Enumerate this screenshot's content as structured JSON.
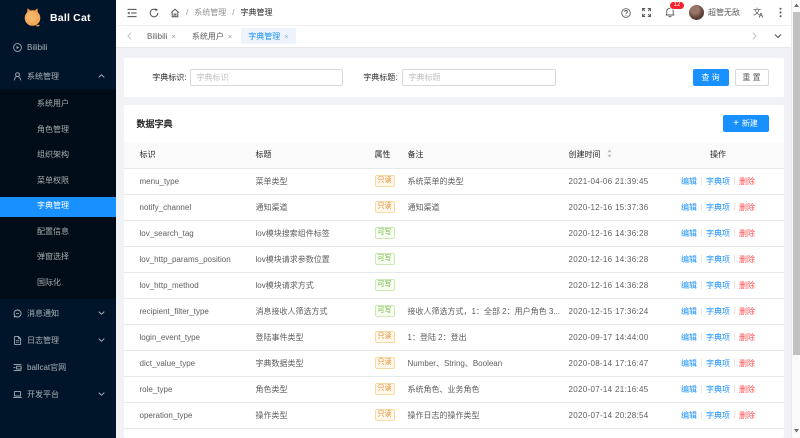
{
  "app": {
    "logo_text": "Ball Cat"
  },
  "sidebar": {
    "top_items": [
      {
        "label": "Bilibili",
        "icon": "play-circle-icon",
        "caret": ""
      },
      {
        "label": "系统管理",
        "icon": "user-icon",
        "caret": "up"
      }
    ],
    "submenu": [
      {
        "label": "系统用户",
        "selected": false
      },
      {
        "label": "角色管理",
        "selected": false
      },
      {
        "label": "组织架构",
        "selected": false
      },
      {
        "label": "菜单权限",
        "selected": false
      },
      {
        "label": "字典管理",
        "selected": true
      },
      {
        "label": "配置信息",
        "selected": false
      },
      {
        "label": "弹窗选择",
        "selected": false
      },
      {
        "label": "国际化",
        "selected": false
      }
    ],
    "bottom_items": [
      {
        "label": "消息通知",
        "icon": "message-icon",
        "caret": "down"
      },
      {
        "label": "日志管理",
        "icon": "file-icon",
        "caret": "down"
      },
      {
        "label": "ballcat官网",
        "icon": "profile-icon",
        "caret": ""
      },
      {
        "label": "开发平台",
        "icon": "laptop-icon",
        "caret": "down"
      }
    ]
  },
  "header": {
    "breadcrumb": {
      "first": "系统管理",
      "last": "字典管理"
    },
    "notification_count": "12",
    "username": "超管无敌"
  },
  "tabs": [
    {
      "label": "Bilibili",
      "active": false
    },
    {
      "label": "系统用户",
      "active": false
    },
    {
      "label": "字典管理",
      "active": true
    }
  ],
  "filter": {
    "field1_label": "字典标识:",
    "field1_placeholder": "字典标识",
    "field2_label": "字典标题:",
    "field2_placeholder": "字典标题",
    "search_label": "查 询",
    "reset_label": "重 置"
  },
  "main": {
    "card_title": "数据字典",
    "new_label": "新建"
  },
  "table": {
    "columns": [
      "标识",
      "标题",
      "属性",
      "备注",
      "创建时间",
      "操作"
    ],
    "actions": [
      "编辑",
      "字典项",
      "删除"
    ],
    "rows": [
      {
        "code": "menu_type",
        "title": "菜单类型",
        "attr": "只读",
        "attr_type": "readonly",
        "remark": "系统菜单的类型",
        "created": "2021-04-06 21:39:45"
      },
      {
        "code": "notify_channel",
        "title": "通知渠道",
        "attr": "只读",
        "attr_type": "readonly",
        "remark": "通知渠道",
        "created": "2020-12-16 15:37:36"
      },
      {
        "code": "lov_search_tag",
        "title": "lov模块搜索组件标签",
        "attr": "可写",
        "attr_type": "writable",
        "remark": "",
        "created": "2020-12-16 14:36:28"
      },
      {
        "code": "lov_http_params_position",
        "title": "lov模块请求参数位置",
        "attr": "可写",
        "attr_type": "writable",
        "remark": "",
        "created": "2020-12-16 14:36:28"
      },
      {
        "code": "lov_http_method",
        "title": "lov模块请求方式",
        "attr": "可写",
        "attr_type": "writable",
        "remark": "",
        "created": "2020-12-16 14:36:28"
      },
      {
        "code": "recipient_filter_type",
        "title": "消息接收人筛选方式",
        "attr": "可写",
        "attr_type": "writable",
        "remark": "接收人筛选方式，1：全部 2：用户角色 3...",
        "created": "2020-12-15 17:36:24"
      },
      {
        "code": "login_event_type",
        "title": "登陆事件类型",
        "attr": "只读",
        "attr_type": "readonly",
        "remark": "1：登陆 2：登出",
        "created": "2020-09-17 14:44:00"
      },
      {
        "code": "dict_value_type",
        "title": "字典数据类型",
        "attr": "只读",
        "attr_type": "readonly",
        "remark": "Number、String、Boolean",
        "created": "2020-08-14 17:16:47"
      },
      {
        "code": "role_type",
        "title": "角色类型",
        "attr": "只读",
        "attr_type": "readonly",
        "remark": "系统角色、业务角色",
        "created": "2020-07-14 21:16:45"
      },
      {
        "code": "operation_type",
        "title": "操作类型",
        "attr": "只读",
        "attr_type": "readonly",
        "remark": "操作日志的操作类型",
        "created": "2020-07-14 20:28:54"
      }
    ]
  }
}
